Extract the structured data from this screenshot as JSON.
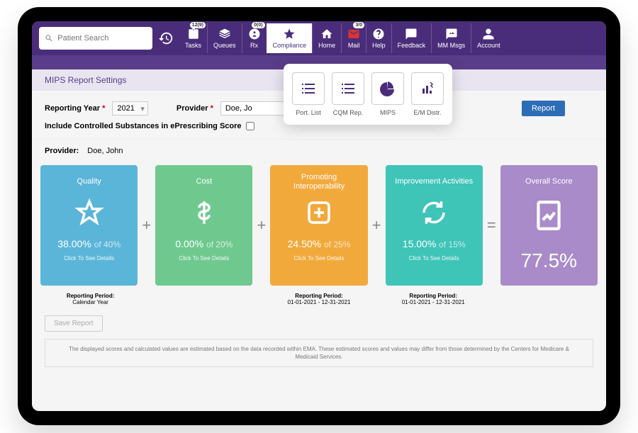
{
  "search": {
    "placeholder": "Patient Search"
  },
  "nav": {
    "tasks": {
      "label": "Tasks",
      "badge": "12(9)"
    },
    "queues": {
      "label": "Queues"
    },
    "rx": {
      "label": "Rx",
      "badge": "0(0)"
    },
    "compliance": {
      "label": "Compliance"
    },
    "home": {
      "label": "Home"
    },
    "mail": {
      "label": "Mail",
      "badge": "3/0"
    },
    "help": {
      "label": "Help"
    },
    "feedback": {
      "label": "Feedback"
    },
    "mmmsgs": {
      "label": "MM Msgs"
    },
    "account": {
      "label": "Account"
    }
  },
  "dropdown": {
    "portlist": "Port. List",
    "cqmrep": "CQM Rep.",
    "mips": "MIPS",
    "emdistr": "E/M Distr."
  },
  "section_title": "MIPS Report Settings",
  "form": {
    "year_label": "Reporting Year",
    "year_value": "2021",
    "provider_label": "Provider",
    "provider_value": "Doe, Jo",
    "run_label": "Report",
    "checkbox_label": "Include Controlled Substances in ePrescribing Score"
  },
  "provider_line": {
    "label": "Provider:",
    "value": "Doe, John"
  },
  "cards": {
    "quality": {
      "title": "Quality",
      "score": "38.00%",
      "of": "of 40%",
      "details": "Click To See Details",
      "period_label": "Reporting Period:",
      "period_value": "Calendar Year"
    },
    "cost": {
      "title": "Cost",
      "score": "0.00%",
      "of": "of 20%",
      "details": "Click To See Details"
    },
    "interop": {
      "title": "Promoting Interoperability",
      "score": "24.50%",
      "of": "of 25%",
      "details": "Click To See Details",
      "period_label": "Reporting Period:",
      "period_value": "01-01-2021 - 12-31-2021"
    },
    "improve": {
      "title": "Improvement Activities",
      "score": "15.00%",
      "of": "of 15%",
      "details": "Click To See Details",
      "period_label": "Reporting Period:",
      "period_value": "01-01-2021 - 12-31-2021"
    },
    "overall": {
      "title": "Overall Score",
      "score": "77.5%"
    }
  },
  "save_label": "Save Report",
  "disclaimer": "The displayed scores and calculated values are estimated based on the data recorded within EMA. These estimated scores and values may differ from those determined by the Centers for Medicare & Medicaid Services."
}
